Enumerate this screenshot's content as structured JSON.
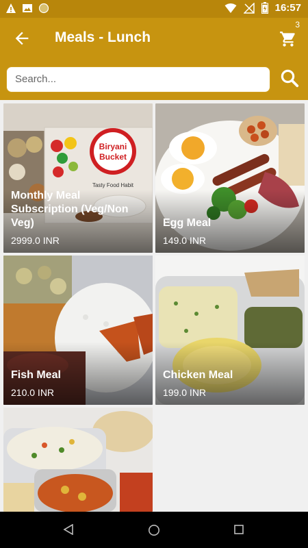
{
  "status": {
    "time": "16:57"
  },
  "app_bar": {
    "title": "Meals - Lunch",
    "cart_count": "3"
  },
  "search": {
    "placeholder": "Search..."
  },
  "items": [
    {
      "name": "Monthly Meal Subscription (Veg/Non Veg)",
      "price": "2999.0 INR",
      "image_text": "Biryani Bucket",
      "image_subtext": "Tasty Food Habit"
    },
    {
      "name": "Egg Meal",
      "price": "149.0 INR"
    },
    {
      "name": "Fish Meal",
      "price": "210.0 INR"
    },
    {
      "name": "Chicken Meal",
      "price": "199.0 INR"
    },
    {
      "name": "",
      "price": ""
    }
  ]
}
